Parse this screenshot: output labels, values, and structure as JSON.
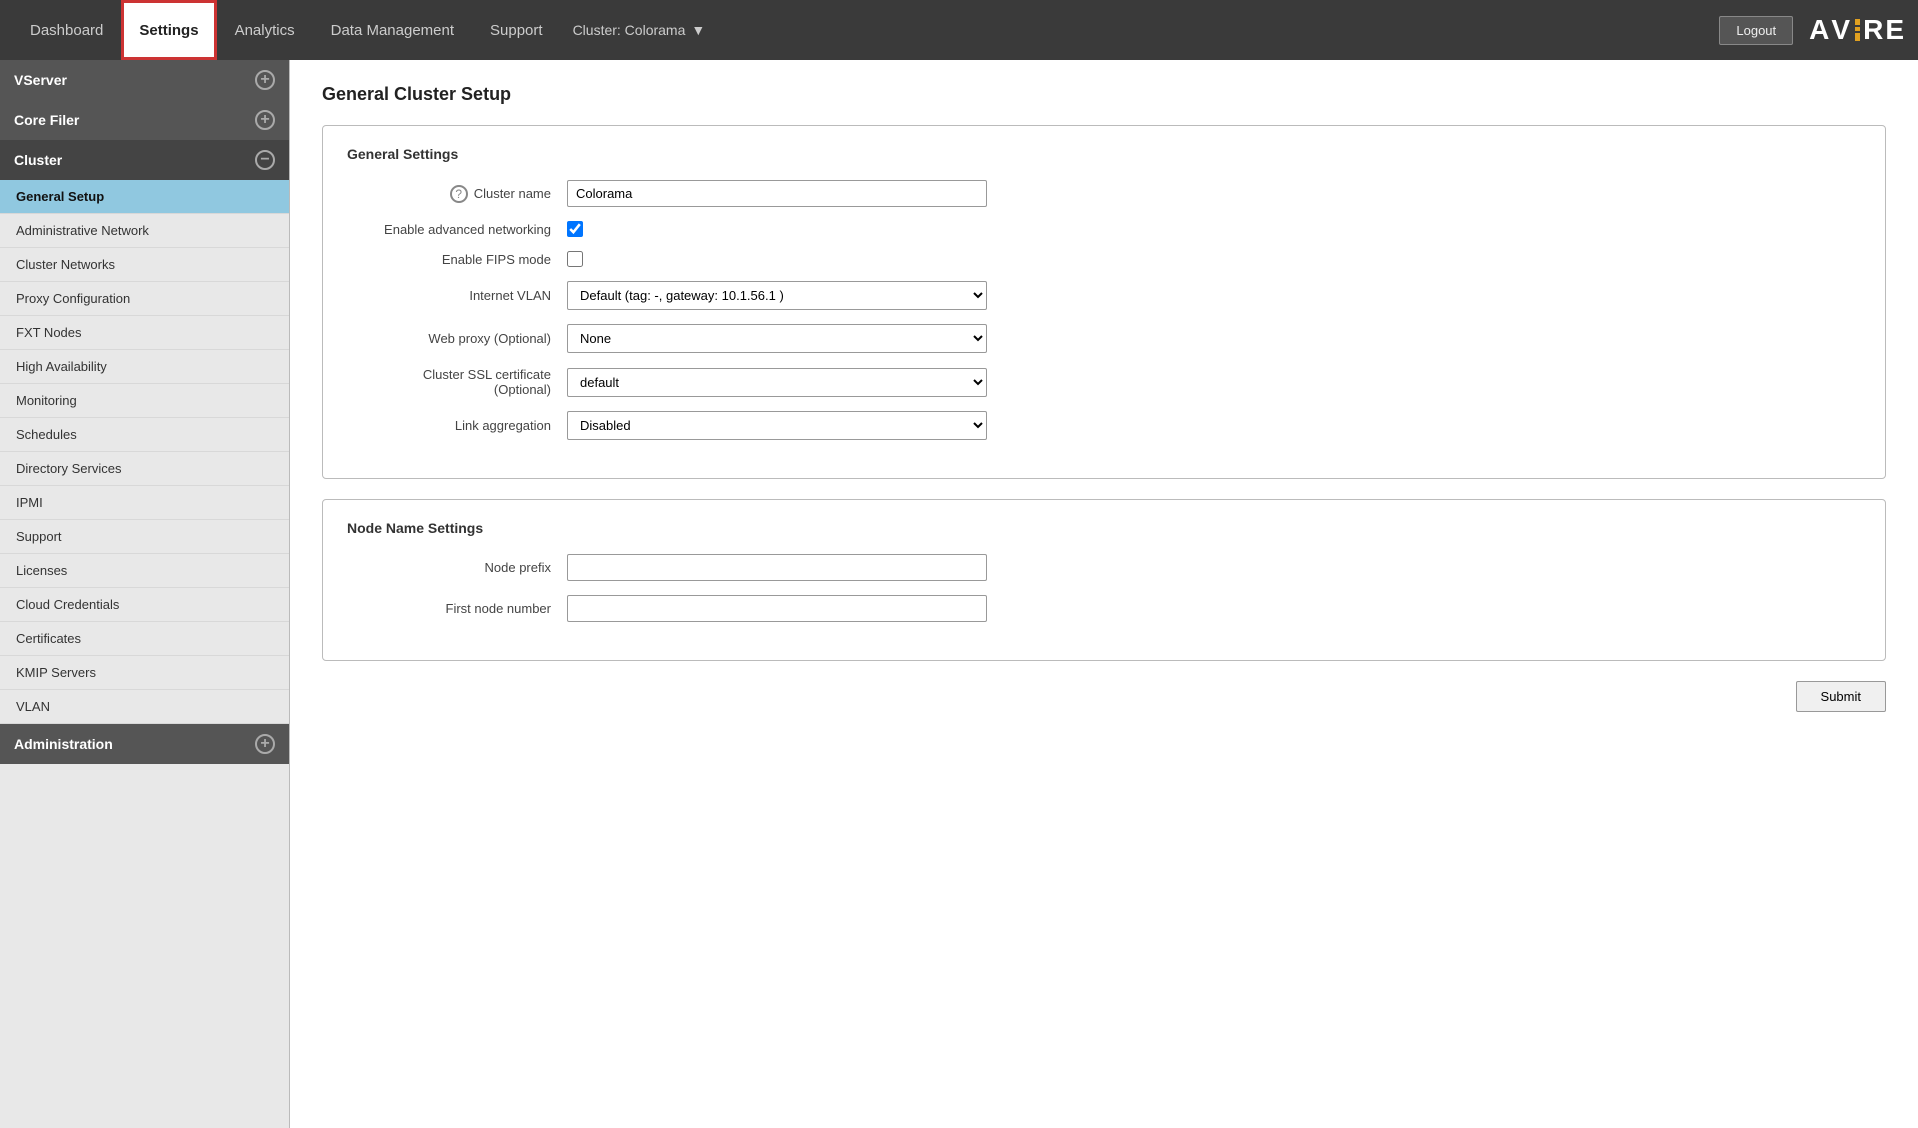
{
  "topbar": {
    "tabs": [
      {
        "label": "Dashboard",
        "active": false
      },
      {
        "label": "Settings",
        "active": true
      },
      {
        "label": "Analytics",
        "active": false
      },
      {
        "label": "Data Management",
        "active": false
      },
      {
        "label": "Support",
        "active": false
      }
    ],
    "cluster_label": "Cluster: Colorama",
    "logout_label": "Logout",
    "logo_text": "AVERE"
  },
  "sidebar": {
    "sections": [
      {
        "label": "VServer",
        "icon": "+",
        "expanded": false,
        "items": []
      },
      {
        "label": "Core Filer",
        "icon": "+",
        "expanded": false,
        "items": []
      },
      {
        "label": "Cluster",
        "icon": "−",
        "expanded": true,
        "items": [
          {
            "label": "General Setup",
            "active": true
          },
          {
            "label": "Administrative Network",
            "active": false
          },
          {
            "label": "Cluster Networks",
            "active": false
          },
          {
            "label": "Proxy Configuration",
            "active": false
          },
          {
            "label": "FXT Nodes",
            "active": false
          },
          {
            "label": "High Availability",
            "active": false
          },
          {
            "label": "Monitoring",
            "active": false
          },
          {
            "label": "Schedules",
            "active": false
          },
          {
            "label": "Directory Services",
            "active": false
          },
          {
            "label": "IPMI",
            "active": false
          },
          {
            "label": "Support",
            "active": false
          },
          {
            "label": "Licenses",
            "active": false
          },
          {
            "label": "Cloud Credentials",
            "active": false
          },
          {
            "label": "Certificates",
            "active": false
          },
          {
            "label": "KMIP Servers",
            "active": false
          },
          {
            "label": "VLAN",
            "active": false
          }
        ]
      },
      {
        "label": "Administration",
        "icon": "+",
        "expanded": false,
        "items": []
      }
    ]
  },
  "content": {
    "page_title": "General Cluster Setup",
    "general_settings": {
      "section_title": "General Settings",
      "cluster_name_label": "Cluster name",
      "cluster_name_value": "Colorama",
      "cluster_name_placeholder": "",
      "enable_advanced_networking_label": "Enable advanced networking",
      "enable_advanced_networking_checked": true,
      "enable_fips_label": "Enable FIPS mode",
      "enable_fips_checked": false,
      "internet_vlan_label": "Internet VLAN",
      "internet_vlan_options": [
        "Default (tag: -, gateway: 10.1.56.1 )"
      ],
      "internet_vlan_selected": "Default (tag: -, gateway: 10.1.56.1 )",
      "web_proxy_label": "Web proxy (Optional)",
      "web_proxy_options": [
        "None"
      ],
      "web_proxy_selected": "None",
      "ssl_cert_label": "Cluster SSL certificate",
      "ssl_cert_sub_label": "(Optional)",
      "ssl_cert_options": [
        "default"
      ],
      "ssl_cert_selected": "default",
      "link_aggregation_label": "Link aggregation",
      "link_aggregation_options": [
        "Disabled"
      ],
      "link_aggregation_selected": "Disabled"
    },
    "node_name_settings": {
      "section_title": "Node Name Settings",
      "node_prefix_label": "Node prefix",
      "node_prefix_value": "",
      "first_node_label": "First node number",
      "first_node_value": ""
    },
    "submit_label": "Submit"
  }
}
